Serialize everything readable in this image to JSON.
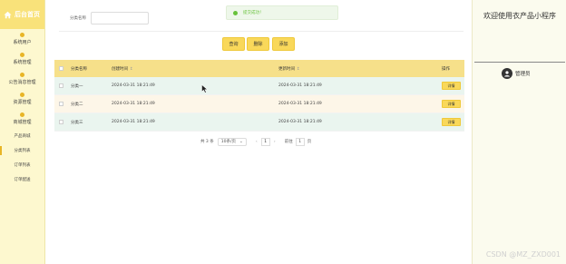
{
  "brand": {
    "title": "后台首页"
  },
  "sidebar": {
    "menus": [
      {
        "label": "系统用户",
        "icon": "user-icon"
      },
      {
        "label": "系统管理",
        "icon": "settings-icon"
      },
      {
        "label": "公告消息管理",
        "icon": "bell-icon"
      },
      {
        "label": "资源管理",
        "icon": "folder-icon"
      },
      {
        "label": "商城管理",
        "icon": "shop-icon"
      }
    ],
    "submenu": [
      {
        "label": "产品商城",
        "active": false
      },
      {
        "label": "分类列表",
        "active": true
      },
      {
        "label": "订单列表",
        "active": false
      },
      {
        "label": "订单配送",
        "active": false
      }
    ]
  },
  "search": {
    "label": "分类名称",
    "placeholder": "",
    "value": ""
  },
  "toast": {
    "text": "提交成功！"
  },
  "toolbar": {
    "search_label": "查询",
    "delete_label": "删除",
    "add_label": "添加"
  },
  "table": {
    "headers": {
      "name": "分类名称",
      "created": "创建时间",
      "updated": "更新时间",
      "op": "操作"
    },
    "rows": [
      {
        "name": "分类一",
        "created": "2024-03-31 18:21:49",
        "updated": "2024-03-31 18:21:49",
        "action": "详情"
      },
      {
        "name": "分类二",
        "created": "2024-03-31 18:21:49",
        "updated": "2024-03-31 18:21:49",
        "action": "详情"
      },
      {
        "name": "分类三",
        "created": "2024-03-31 18:21:49",
        "updated": "2024-03-31 18:21:49",
        "action": "详情"
      }
    ]
  },
  "pagination": {
    "total": "共 3 条",
    "page_size": "10条/页",
    "current": "1",
    "goto_label": "前往",
    "goto_value": "1",
    "page_suffix": "页"
  },
  "right_panel": {
    "welcome": "欢迎使用衣产品小程序",
    "user": "管理员"
  },
  "watermark": "CSDN @MZ_ZXD001",
  "colors": {
    "accent": "#f9d85a",
    "sidebar_bg": "#fdf8cf",
    "success": "#67c23a"
  }
}
